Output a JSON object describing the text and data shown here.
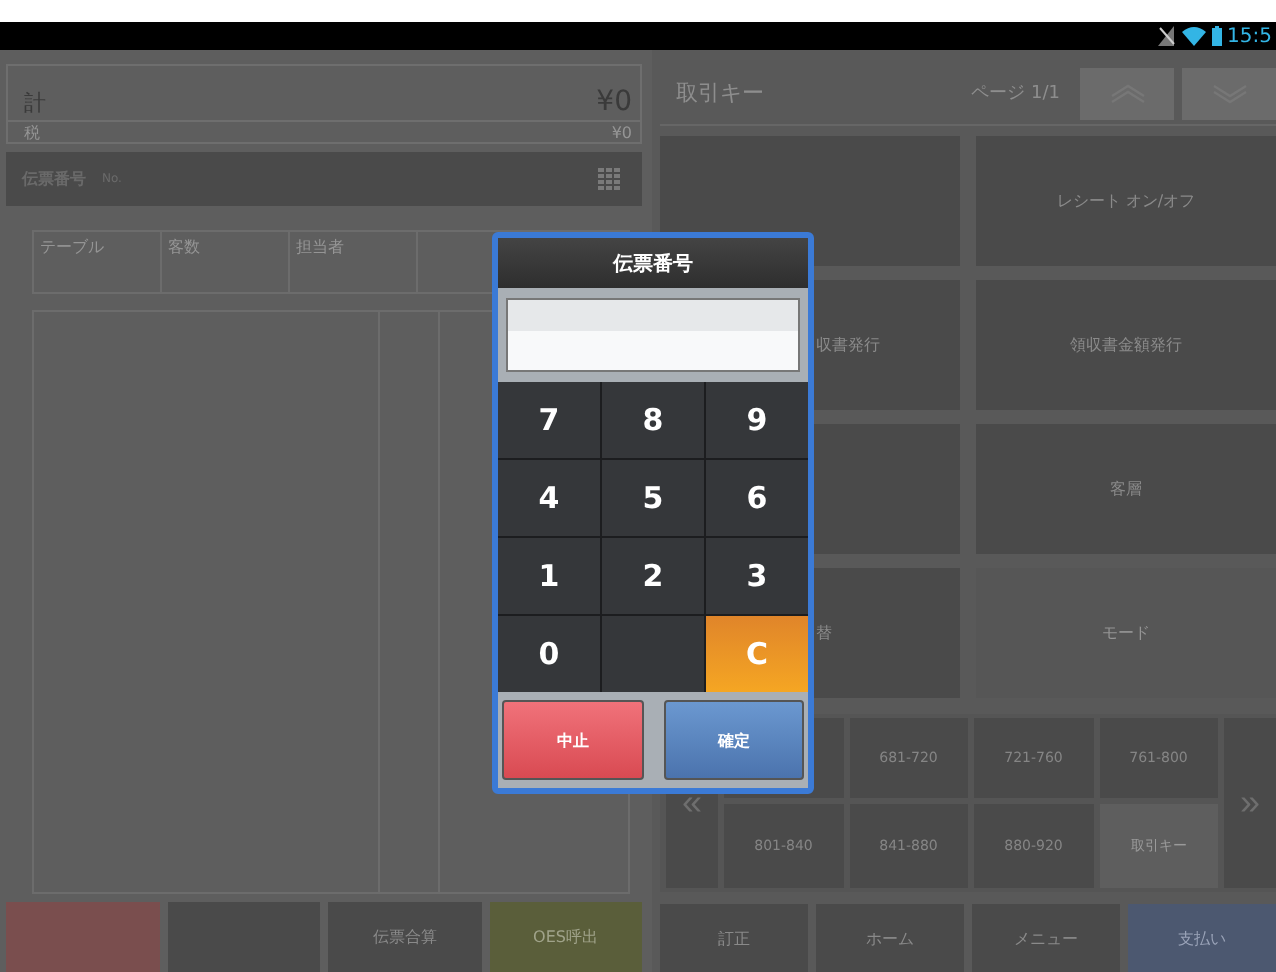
{
  "status_bar": {
    "time": "15:5"
  },
  "total": {
    "label": "計",
    "amount": "¥0",
    "tax_label": "税",
    "tax_amount": "¥0"
  },
  "slip_bar": {
    "label": "伝票番号",
    "sub": "No."
  },
  "info_columns": [
    "テーブル",
    "客数",
    "担当者"
  ],
  "bottom_left_buttons": [
    {
      "kind": "danger"
    },
    {
      "kind": "plain"
    },
    {
      "kind": "plain",
      "label": "伝票合算"
    },
    {
      "kind": "accent",
      "label": "OES呼出"
    }
  ],
  "keys_panel": {
    "title": "取引キー",
    "page": "ページ 1/1",
    "tiles": [
      {
        "kind": "plain"
      },
      {
        "kind": "plain",
        "label": "レシート オン/オフ"
      },
      {
        "kind": "plain",
        "label": "収書発行"
      },
      {
        "kind": "plain",
        "label": "領収書金額発行"
      },
      {
        "kind": "plain"
      },
      {
        "kind": "plain",
        "label": "客層"
      },
      {
        "kind": "plain",
        "label": "替"
      },
      {
        "kind": "light",
        "label": "モード"
      }
    ],
    "prev": "«",
    "next": "»",
    "ranges": [
      {
        "selected": false
      },
      {
        "label": "681-720",
        "selected": false
      },
      {
        "label": "721-760",
        "selected": false
      },
      {
        "label": "761-800",
        "selected": false
      },
      {
        "label": "801-840",
        "selected": false
      },
      {
        "label": "841-880",
        "selected": false
      },
      {
        "label": "880-920",
        "selected": false
      },
      {
        "label": "取引キー",
        "selected": true
      }
    ]
  },
  "bottom_right_buttons": [
    {
      "kind": "plain",
      "label": "訂正"
    },
    {
      "kind": "plain",
      "label": "ホーム"
    },
    {
      "kind": "plain",
      "label": "メニュー"
    },
    {
      "kind": "primary",
      "label": "支払い"
    }
  ],
  "dialog": {
    "title": "伝票番号",
    "keys": [
      {
        "kind": "digit",
        "label": "7"
      },
      {
        "kind": "digit",
        "label": "8"
      },
      {
        "kind": "digit",
        "label": "9"
      },
      {
        "kind": "digit",
        "label": "4"
      },
      {
        "kind": "digit",
        "label": "5"
      },
      {
        "kind": "digit",
        "label": "6"
      },
      {
        "kind": "digit",
        "label": "1"
      },
      {
        "kind": "digit",
        "label": "2"
      },
      {
        "kind": "digit",
        "label": "3"
      },
      {
        "kind": "digit",
        "label": "0"
      },
      {
        "kind": "blank"
      },
      {
        "kind": "clear",
        "label": "C"
      }
    ],
    "actions": [
      {
        "kind": "cancel",
        "label": "中止"
      },
      {
        "kind": "confirm",
        "label": "確定"
      }
    ]
  }
}
